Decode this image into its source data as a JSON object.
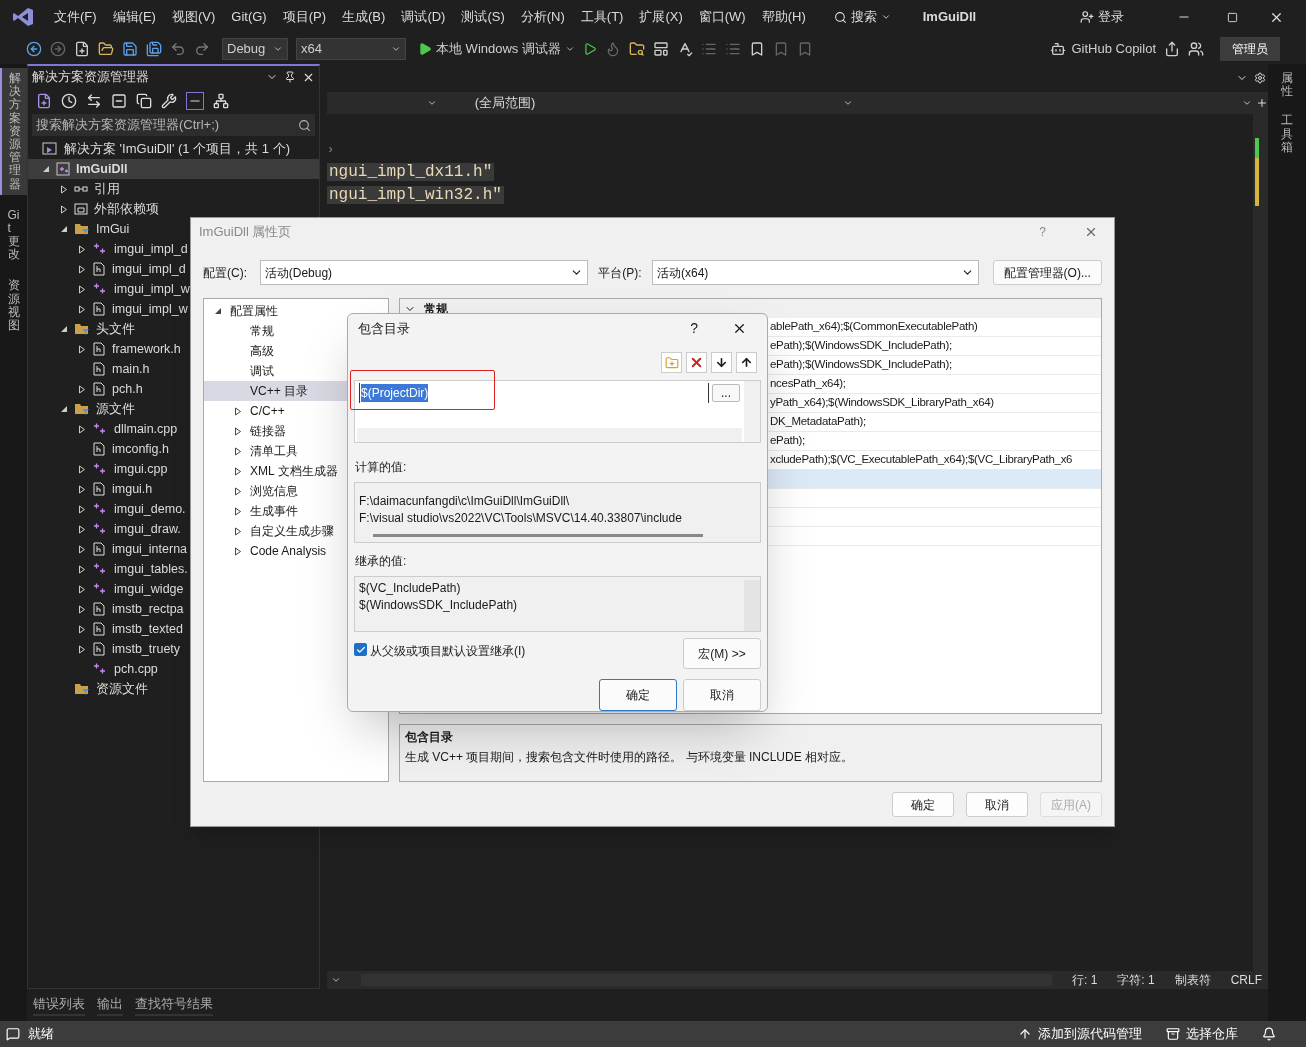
{
  "title_bar": {
    "menu": [
      "文件(F)",
      "编辑(E)",
      "视图(V)",
      "Git(G)",
      "项目(P)",
      "生成(B)",
      "调试(D)",
      "测试(S)",
      "分析(N)",
      "工具(T)",
      "扩展(X)",
      "窗口(W)",
      "帮助(H)"
    ],
    "search": "搜索",
    "title": "ImGuiDll",
    "login": "登录"
  },
  "toolbar": {
    "configuration": "Debug",
    "platform": "x64",
    "debugger": "本地 Windows 调试器",
    "copilot": "GitHub Copilot",
    "admin": "管理员"
  },
  "side_tabs_left": [
    {
      "label": "解决方案资源管理器",
      "selected": true
    },
    {
      "label": "Git 更改",
      "selected": false
    },
    {
      "label": "资源视图",
      "selected": false
    }
  ],
  "side_tabs_right": [
    "属性",
    "工具箱"
  ],
  "solution_explorer": {
    "title": "解决方案资源管理器",
    "search": {
      "placeholder": "搜索解决方案资源管理器(Ctrl+;)"
    },
    "solution": "解决方案 'ImGuiDll' (1 个项目，共 1 个)",
    "tree": [
      {
        "label": "ImGuiDll",
        "kind": "project",
        "expanded": true,
        "selected": true,
        "children": [
          {
            "label": "引用",
            "kind": "references",
            "expanded": false,
            "selected": false
          },
          {
            "label": "外部依赖项",
            "kind": "external",
            "expanded": false,
            "selected": false
          },
          {
            "label": "ImGui",
            "kind": "filter",
            "expanded": true,
            "selected": false,
            "children": [
              {
                "label": "imgui_impl_d",
                "kind": "cpp",
                "expanded": false,
                "selected": false
              },
              {
                "label": "imgui_impl_d",
                "kind": "header",
                "expanded": false,
                "selected": false
              },
              {
                "label": "imgui_impl_w",
                "kind": "cpp",
                "expanded": false,
                "selected": false
              },
              {
                "label": "imgui_impl_w",
                "kind": "header",
                "expanded": false,
                "selected": false
              }
            ]
          },
          {
            "label": "头文件",
            "kind": "filter",
            "expanded": true,
            "selected": false,
            "children": [
              {
                "label": "framework.h",
                "kind": "header",
                "expanded": false,
                "selected": false
              },
              {
                "label": "main.h",
                "kind": "header",
                "selected": false
              },
              {
                "label": "pch.h",
                "kind": "header",
                "expanded": false,
                "selected": false
              }
            ]
          },
          {
            "label": "源文件",
            "kind": "filter",
            "expanded": true,
            "selected": false,
            "children": [
              {
                "label": "dllmain.cpp",
                "kind": "cpp",
                "expanded": false,
                "selected": false
              },
              {
                "label": "imconfig.h",
                "kind": "header",
                "selected": false
              },
              {
                "label": "imgui.cpp",
                "kind": "cpp",
                "expanded": false,
                "selected": false
              },
              {
                "label": "imgui.h",
                "kind": "header",
                "expanded": false,
                "selected": false
              },
              {
                "label": "imgui_demo.",
                "kind": "cpp",
                "expanded": false,
                "selected": false
              },
              {
                "label": "imgui_draw.",
                "kind": "cpp",
                "expanded": false,
                "selected": false
              },
              {
                "label": "imgui_interna",
                "kind": "header",
                "expanded": false,
                "selected": false
              },
              {
                "label": "imgui_tables.",
                "kind": "cpp",
                "expanded": false,
                "selected": false
              },
              {
                "label": "imgui_widge",
                "kind": "cpp",
                "expanded": false,
                "selected": false
              },
              {
                "label": "imstb_rectpa",
                "kind": "header",
                "expanded": false,
                "selected": false
              },
              {
                "label": "imstb_texted",
                "kind": "header",
                "expanded": false,
                "selected": false
              },
              {
                "label": "imstb_truety",
                "kind": "header",
                "expanded": false,
                "selected": false
              },
              {
                "label": "pch.cpp",
                "kind": "cpp",
                "selected": false
              }
            ]
          },
          {
            "label": "资源文件",
            "kind": "filter",
            "selected": false
          }
        ]
      }
    ]
  },
  "editor": {
    "scope": "(全局范围)",
    "lines": [
      "›",
      "ngui_impl_dx11.h\"",
      "ngui_impl_win32.h\""
    ],
    "status": {
      "line": "行: 1",
      "char": "字符: 1",
      "tabs": "制表符",
      "eol": "CRLF"
    }
  },
  "bottom_tabs": [
    "错误列表",
    "输出",
    "查找符号结果"
  ],
  "status_bar": {
    "state": "就绪",
    "source_control": "添加到源代码管理",
    "repository": "选择仓库"
  },
  "property_page": {
    "title": "ImGuiDll 属性页",
    "help": "?",
    "configuration": {
      "label": "配置(C):",
      "value": "活动(Debug)"
    },
    "platform": {
      "label": "平台(P):",
      "value": "活动(x64)"
    },
    "config_manager": "配置管理器(O)...",
    "tree": [
      {
        "label": "配置属性",
        "expanded": true,
        "selected": false,
        "children": [
          {
            "label": "常规",
            "selected": false
          },
          {
            "label": "高级",
            "selected": false
          },
          {
            "label": "调试",
            "selected": false
          },
          {
            "label": "VC++ 目录",
            "selected": true
          },
          {
            "label": "C/C++",
            "expanded": false,
            "selected": false
          },
          {
            "label": "链接器",
            "expanded": false,
            "selected": false
          },
          {
            "label": "清单工具",
            "expanded": false,
            "selected": false
          },
          {
            "label": "XML 文档生成器",
            "expanded": false,
            "selected": false
          },
          {
            "label": "浏览信息",
            "expanded": false,
            "selected": false
          },
          {
            "label": "生成事件",
            "expanded": false,
            "selected": false
          },
          {
            "label": "自定义生成步骤",
            "expanded": false,
            "selected": false
          },
          {
            "label": "Code Analysis",
            "expanded": false,
            "selected": false
          }
        ]
      }
    ],
    "section": "常规",
    "rows": [
      {
        "value": "ablePath_x64);$(CommonExecutablePath)",
        "selected": false
      },
      {
        "value": "ePath);$(WindowsSDK_IncludePath);",
        "selected": false
      },
      {
        "value": "ePath);$(WindowsSDK_IncludePath);",
        "selected": false
      },
      {
        "value": "ncesPath_x64);",
        "selected": false
      },
      {
        "value": "yPath_x64);$(WindowsSDK_LibraryPath_x64)",
        "selected": false
      },
      {
        "value": "DK_MetadataPath);",
        "selected": false
      },
      {
        "value": "ePath);",
        "selected": false
      },
      {
        "value": "xcludePath);$(VC_ExecutablePath_x64);$(VC_LibraryPath_x6",
        "selected": false
      },
      {
        "selected": true
      },
      {
        "selected": false
      },
      {
        "selected": false
      },
      {
        "selected": false
      }
    ],
    "description": {
      "title": "包含目录",
      "text": "生成 VC++ 项目期间，搜索包含文件时使用的路径。 与环境变量 INCLUDE 相对应。"
    },
    "buttons": [
      {
        "label": "确定",
        "disabled": false
      },
      {
        "label": "取消",
        "disabled": false
      },
      {
        "label": "应用(A)",
        "disabled": true
      }
    ]
  },
  "include_dialog": {
    "title": "包含目录",
    "help": "?",
    "entries": [
      {
        "value": "$(ProjectDir)",
        "selected": true
      }
    ],
    "browse": "...",
    "computed_label": "计算的值:",
    "computed": [
      "F:\\daimacunfangdi\\c\\ImGuiDll\\ImGuiDll\\",
      "F:\\visual studio\\vs2022\\VC\\Tools\\MSVC\\14.40.33807\\include"
    ],
    "inherited_label": "继承的值:",
    "inherited": [
      "$(VC_IncludePath)",
      "$(WindowsSDK_IncludePath)"
    ],
    "inherit": {
      "label": "从父级或项目默认设置继承(I)",
      "checked": true
    },
    "macros": "宏(M) >>",
    "buttons": [
      {
        "label": "确定",
        "default": true
      },
      {
        "label": "取消",
        "default": false
      }
    ]
  }
}
